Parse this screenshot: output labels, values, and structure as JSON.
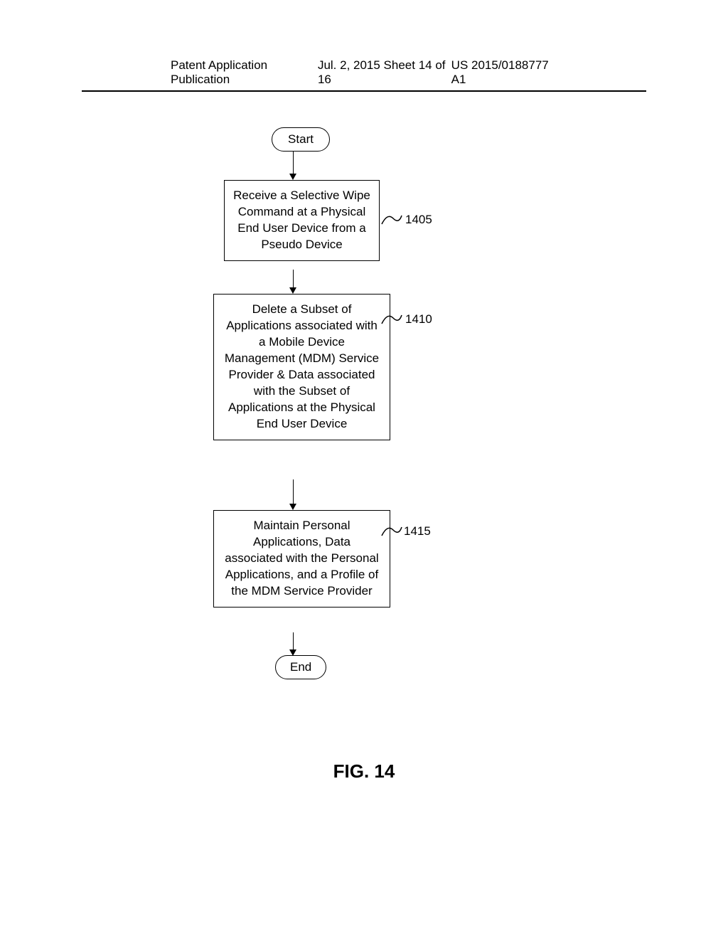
{
  "header": {
    "left": "Patent Application Publication",
    "center": "Jul. 2, 2015   Sheet 14 of 16",
    "right": "US 2015/0188777 A1"
  },
  "flowchart": {
    "start": "Start",
    "end": "End",
    "box1": "Receive a Selective Wipe Command at a Physical End User Device from a Pseudo Device",
    "box2": "Delete a Subset of Applications associated with a Mobile Device Management (MDM) Service Provider & Data associated with the Subset of Applications at the Physical End User Device",
    "box3": "Maintain Personal Applications, Data associated with the Personal Applications, and a Profile of the MDM Service Provider",
    "label1": "1405",
    "label2": "1410",
    "label3": "1415"
  },
  "figure_label": "FIG. 14",
  "chart_data": {
    "type": "flowchart",
    "nodes": [
      {
        "id": "start",
        "type": "terminal",
        "label": "Start"
      },
      {
        "id": "1405",
        "type": "process",
        "label": "Receive a Selective Wipe Command at a Physical End User Device from a Pseudo Device",
        "ref": "1405"
      },
      {
        "id": "1410",
        "type": "process",
        "label": "Delete a Subset of Applications associated with a Mobile Device Management (MDM) Service Provider & Data associated with the Subset of Applications at the Physical End User Device",
        "ref": "1410"
      },
      {
        "id": "1415",
        "type": "process",
        "label": "Maintain Personal Applications, Data associated with the Personal Applications, and a Profile of the MDM Service Provider",
        "ref": "1415"
      },
      {
        "id": "end",
        "type": "terminal",
        "label": "End"
      }
    ],
    "edges": [
      {
        "from": "start",
        "to": "1405"
      },
      {
        "from": "1405",
        "to": "1410"
      },
      {
        "from": "1410",
        "to": "1415"
      },
      {
        "from": "1415",
        "to": "end"
      }
    ]
  }
}
